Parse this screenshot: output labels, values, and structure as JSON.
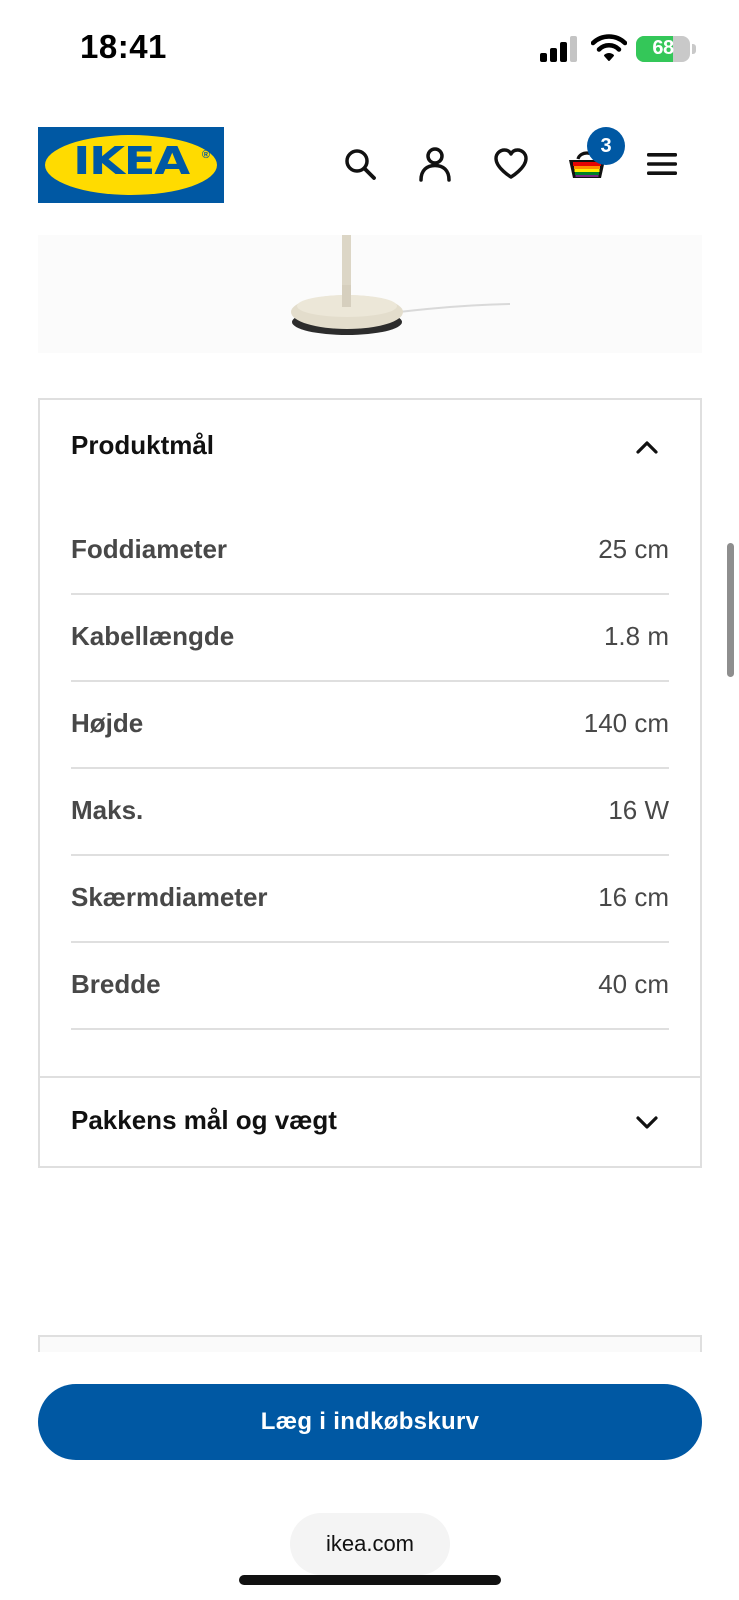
{
  "status_bar": {
    "time": "18:41",
    "battery_percent": "68",
    "battery_level": 0.68
  },
  "header": {
    "logo_text": "IKEA",
    "cart_count": "3",
    "icons": [
      "search-icon",
      "user-icon",
      "heart-icon",
      "cart-icon",
      "menu-icon"
    ]
  },
  "dimensions": {
    "title": "Produktmål",
    "expanded": true,
    "rows": [
      {
        "label": "Foddiameter",
        "value": "25 cm"
      },
      {
        "label": "Kabellængde",
        "value": "1.8 m"
      },
      {
        "label": "Højde",
        "value": "140 cm"
      },
      {
        "label": "Maks.",
        "value": "16 W"
      },
      {
        "label": "Skærmdiameter",
        "value": "16 cm"
      },
      {
        "label": "Bredde",
        "value": "40 cm"
      }
    ]
  },
  "package": {
    "title": "Pakkens mål og vægt",
    "expanded": false
  },
  "cta": {
    "label": "Læg i indkøbskurv"
  },
  "browser": {
    "url": "ikea.com"
  },
  "colors": {
    "brand_blue": "#0058a3",
    "brand_yellow": "#ffdb00"
  }
}
